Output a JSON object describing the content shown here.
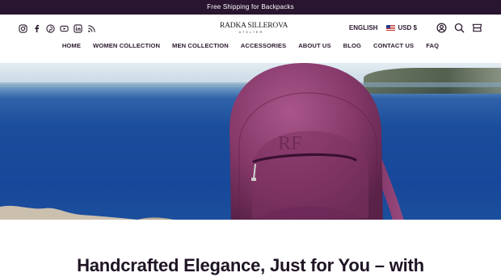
{
  "announcement": {
    "text": "Free Shipping for Backpacks"
  },
  "logo": {
    "brand": "RADKA SILLEROVA",
    "sub": "ATELIER"
  },
  "socials": [
    "instagram-icon",
    "facebook-icon",
    "pinterest-icon",
    "youtube-icon",
    "linkedin-icon",
    "rss-icon"
  ],
  "util": {
    "language": "ENGLISH",
    "currency": "USD $"
  },
  "nav": {
    "items": [
      {
        "label": "HOME"
      },
      {
        "label": "WOMEN COLLECTION"
      },
      {
        "label": "MEN COLLECTION"
      },
      {
        "label": "ACCESSORIES"
      },
      {
        "label": "ABOUT US"
      },
      {
        "label": "BLOG"
      },
      {
        "label": "CONTACT US"
      },
      {
        "label": "FAQ"
      }
    ]
  },
  "hero": {
    "monogram": "RF"
  },
  "headline": {
    "text": "Handcrafted Elegance, Just for You – with"
  },
  "colors": {
    "announcement_bg": "#2a1530",
    "text": "#2b1a2e",
    "bag": "#8a3f6f",
    "sea": "#1a4d9b"
  }
}
